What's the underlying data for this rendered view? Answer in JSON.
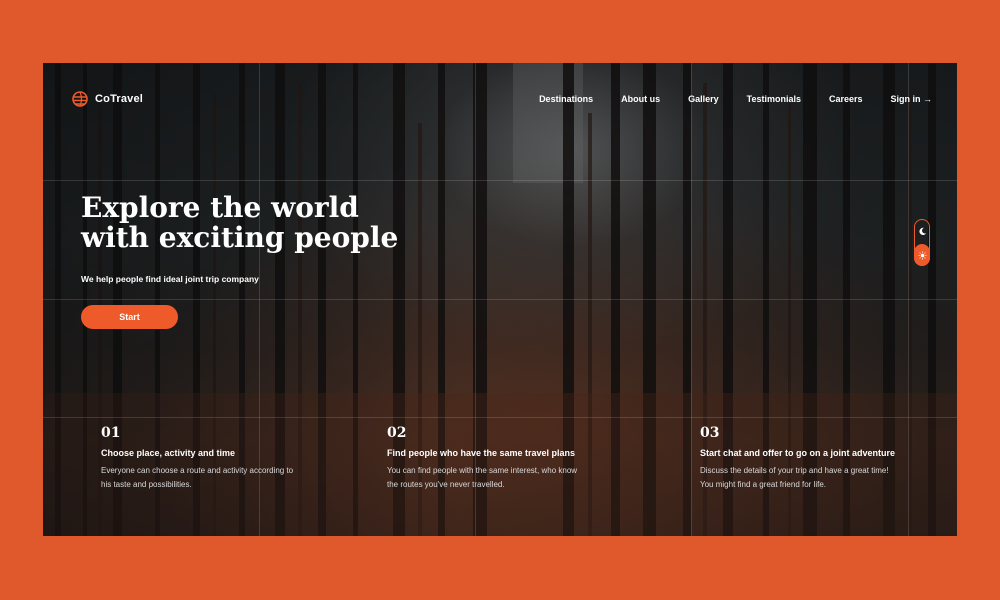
{
  "brand": {
    "name": "CoTravel",
    "accent": "#ef5a2a",
    "background": "#e0592c"
  },
  "nav": {
    "items": [
      "Destinations",
      "About us",
      "Gallery",
      "Testimonials",
      "Careers"
    ],
    "signin": "Sign in →"
  },
  "hero": {
    "title_line1": "Explore the world",
    "title_line2": "with exciting people",
    "subtitle": "We help people find ideal joint trip company",
    "cta": "Start"
  },
  "theme_toggle": {
    "dark_icon": "moon-icon",
    "light_icon": "sun-icon",
    "active": "light"
  },
  "features": [
    {
      "num": "01",
      "title": "Choose place, activity and time",
      "text": "Everyone can choose a route and activity according to his taste and possibilities."
    },
    {
      "num": "02",
      "title": "Find people who have the same travel plans",
      "text": "You can find people with the same interest, who know the routes you've never travelled."
    },
    {
      "num": "03",
      "title": "Start chat and offer to go on a joint adventure",
      "text": "Discuss the details of your trip and have a great time! You might find a great friend for life."
    }
  ]
}
